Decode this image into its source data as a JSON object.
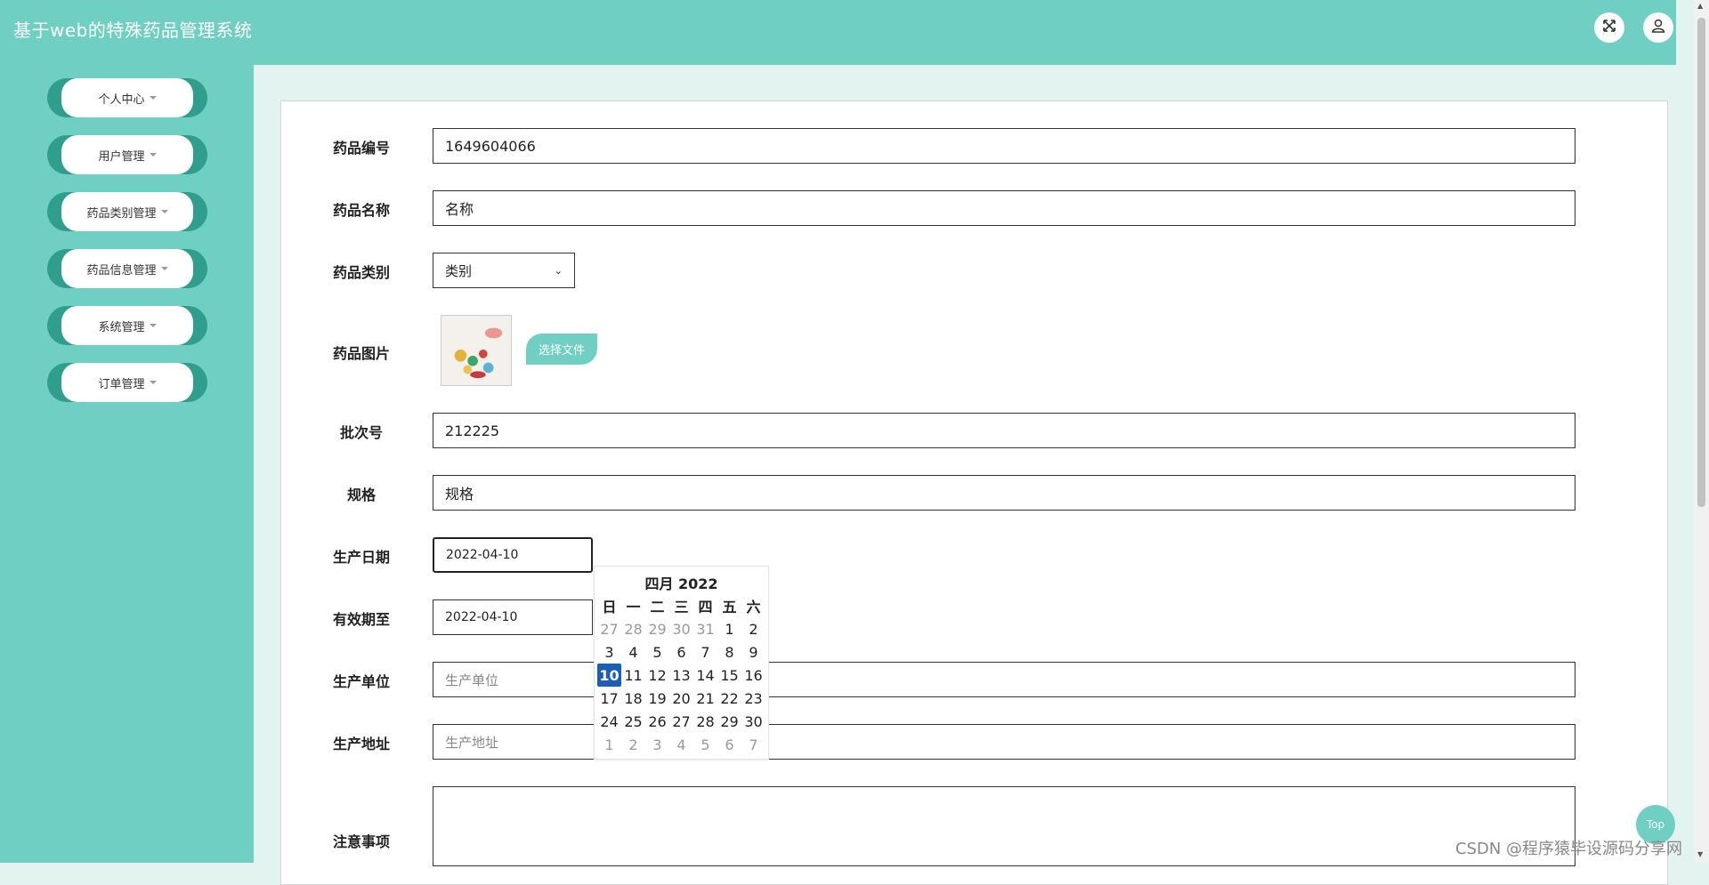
{
  "header": {
    "title": "基于web的特殊药品管理系统",
    "fullscreen_icon": "fullscreen-icon",
    "user_icon": "user-icon"
  },
  "sidebar": {
    "items": [
      {
        "label": "个人中心"
      },
      {
        "label": "用户管理"
      },
      {
        "label": "药品类别管理"
      },
      {
        "label": "药品信息管理"
      },
      {
        "label": "系统管理"
      },
      {
        "label": "订单管理"
      }
    ]
  },
  "form": {
    "code": {
      "label": "药品编号",
      "value": "1649604066"
    },
    "name": {
      "label": "药品名称",
      "value": "名称"
    },
    "category": {
      "label": "药品类别",
      "value": "类别"
    },
    "image": {
      "label": "药品图片",
      "button": "选择文件"
    },
    "batch": {
      "label": "批次号",
      "value": "212225"
    },
    "spec": {
      "label": "规格",
      "value": "规格"
    },
    "prod_date": {
      "label": "生产日期",
      "value": "2022-04-10"
    },
    "expiry": {
      "label": "有效期至",
      "value": "2022-04-10"
    },
    "maker": {
      "label": "生产单位",
      "placeholder": "生产单位"
    },
    "address": {
      "label": "生产地址",
      "placeholder": "生产地址"
    },
    "notes": {
      "label": "注意事项",
      "value": ""
    }
  },
  "datepicker": {
    "title": "四月 2022",
    "weekdays": [
      "日",
      "一",
      "二",
      "三",
      "四",
      "五",
      "六"
    ],
    "weeks": [
      [
        "27",
        "28",
        "29",
        "30",
        "31",
        "1",
        "2"
      ],
      [
        "3",
        "4",
        "5",
        "6",
        "7",
        "8",
        "9"
      ],
      [
        "10",
        "11",
        "12",
        "13",
        "14",
        "15",
        "16"
      ],
      [
        "17",
        "18",
        "19",
        "20",
        "21",
        "22",
        "23"
      ],
      [
        "24",
        "25",
        "26",
        "27",
        "28",
        "29",
        "30"
      ],
      [
        "1",
        "2",
        "3",
        "4",
        "5",
        "6",
        "7"
      ]
    ],
    "selected": "10"
  },
  "top_button": "Top",
  "watermark": "CSDN @程序猿毕设源码分享网",
  "colors": {
    "accent": "#6fcfc2",
    "sidebar_pill": "#2f9e8c",
    "selected_day": "#1a5fb4"
  }
}
